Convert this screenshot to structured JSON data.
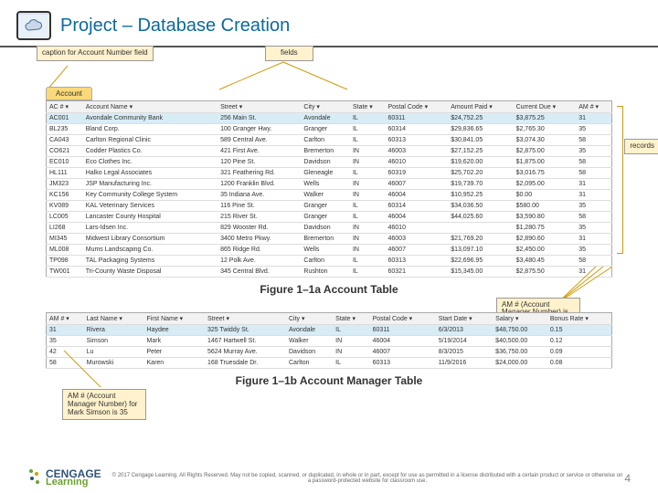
{
  "header": {
    "title": "Project – Database Creation"
  },
  "callouts": {
    "caption_account": "caption for Account Number field",
    "fields": "fields",
    "records": "records",
    "am35_a": "AM # (Account Manager Number) is 35",
    "am35_b": "AM # (Account Manager Number) for Mark Simson is 35"
  },
  "tab_label": "Account",
  "table_a": {
    "headers": [
      "AC #",
      "Account Name",
      "Street",
      "City",
      "State",
      "Postal Code",
      "Amount Paid",
      "Current Due",
      "AM #"
    ],
    "rows": [
      [
        "AC001",
        "Avondale Community Bank",
        "256 Main St.",
        "Avondale",
        "IL",
        "60311",
        "$24,752.25",
        "$3,875.25",
        "31"
      ],
      [
        "BL235",
        "Bland Corp.",
        "100 Granger Hwy.",
        "Granger",
        "IL",
        "60314",
        "$29,836.65",
        "$2,765.30",
        "35"
      ],
      [
        "CA043",
        "Carlton Regional Clinic",
        "589 Central Ave.",
        "Carlton",
        "IL",
        "60313",
        "$30,841.05",
        "$3,074.30",
        "58"
      ],
      [
        "CO621",
        "Codder Plastics Co.",
        "421 First Ave.",
        "Bremerton",
        "IN",
        "46003",
        "$27,152.25",
        "$2,875.00",
        "35"
      ],
      [
        "EC010",
        "Eco Clothes Inc.",
        "120 Pine St.",
        "Davidson",
        "IN",
        "46010",
        "$19,620.00",
        "$1,875.00",
        "58"
      ],
      [
        "HL111",
        "Halko Legal Associates",
        "321 Feathering Rd.",
        "Gleneagle",
        "IL",
        "60319",
        "$25,702.20",
        "$3,016.75",
        "58"
      ],
      [
        "JM323",
        "JSP Manufacturing Inc.",
        "1200 Franklin Blvd.",
        "Wells",
        "IN",
        "46007",
        "$19,739.70",
        "$2,095.00",
        "31"
      ],
      [
        "KC156",
        "Key Community College System",
        "35 Indiana Ave.",
        "Walker",
        "IN",
        "46004",
        "$10,952.25",
        "$0.00",
        "31"
      ],
      [
        "KV089",
        "KAL Veterinary Services",
        "116 Pine St.",
        "Granger",
        "IL",
        "60314",
        "$34,036.50",
        "$580.00",
        "35"
      ],
      [
        "LC005",
        "Lancaster County Hospital",
        "215 River St.",
        "Granger",
        "IL",
        "46004",
        "$44,025.60",
        "$3,590.80",
        "58"
      ],
      [
        "LI268",
        "Lars-Idsen Inc.",
        "829 Wooster Rd.",
        "Davidson",
        "IN",
        "46010",
        "",
        "$1,280.75",
        "35"
      ],
      [
        "MI345",
        "Midwest Library Consortium",
        "3400 Metro Pkwy.",
        "Bremerton",
        "IN",
        "46003",
        "$21,769.20",
        "$2,890.60",
        "31"
      ],
      [
        "ML008",
        "Mums Landscaping Co.",
        "865 Ridge Rd.",
        "Wells",
        "IN",
        "46007",
        "$13,097.10",
        "$2,450.00",
        "35"
      ],
      [
        "TP098",
        "TAL Packaging Systems",
        "12 Polk Ave.",
        "Carlton",
        "IL",
        "60313",
        "$22,696.95",
        "$3,480.45",
        "58"
      ],
      [
        "TW001",
        "Tri-County Waste Disposal",
        "345 Central Blvd.",
        "Rushton",
        "IL",
        "60321",
        "$15,345.00",
        "$2,875.50",
        "31"
      ]
    ]
  },
  "caption_a": "Figure 1–1a Account Table",
  "table_b": {
    "headers": [
      "AM #",
      "Last Name",
      "First Name",
      "Street",
      "City",
      "State",
      "Postal Code",
      "Start Date",
      "Salary",
      "Bonus Rate"
    ],
    "rows": [
      [
        "31",
        "Rivera",
        "Haydee",
        "325 Twiddy St.",
        "Avondale",
        "IL",
        "60311",
        "6/3/2013",
        "$48,750.00",
        "0.15"
      ],
      [
        "35",
        "Simson",
        "Mark",
        "1467 Hartwell St.",
        "Walker",
        "IN",
        "46004",
        "5/19/2014",
        "$40,500.00",
        "0.12"
      ],
      [
        "42",
        "Lu",
        "Peter",
        "5624 Murray Ave.",
        "Davidson",
        "IN",
        "46007",
        "8/3/2015",
        "$36,750.00",
        "0.09"
      ],
      [
        "58",
        "Murowski",
        "Karen",
        "168 Truesdale Dr.",
        "Carlton",
        "IL",
        "60313",
        "11/9/2016",
        "$24,000.00",
        "0.08"
      ]
    ]
  },
  "caption_b": "Figure 1–1b Account Manager Table",
  "footer": {
    "logo_top": "CENGAGE",
    "logo_sub": "Learning",
    "copy": "© 2017 Cengage Learning. All Rights Reserved. May not be copied, scanned, or duplicated, in whole or in part, except for use as permitted in a license distributed with a certain product or service or otherwise on a password-protected website for classroom use.",
    "page": "4"
  }
}
